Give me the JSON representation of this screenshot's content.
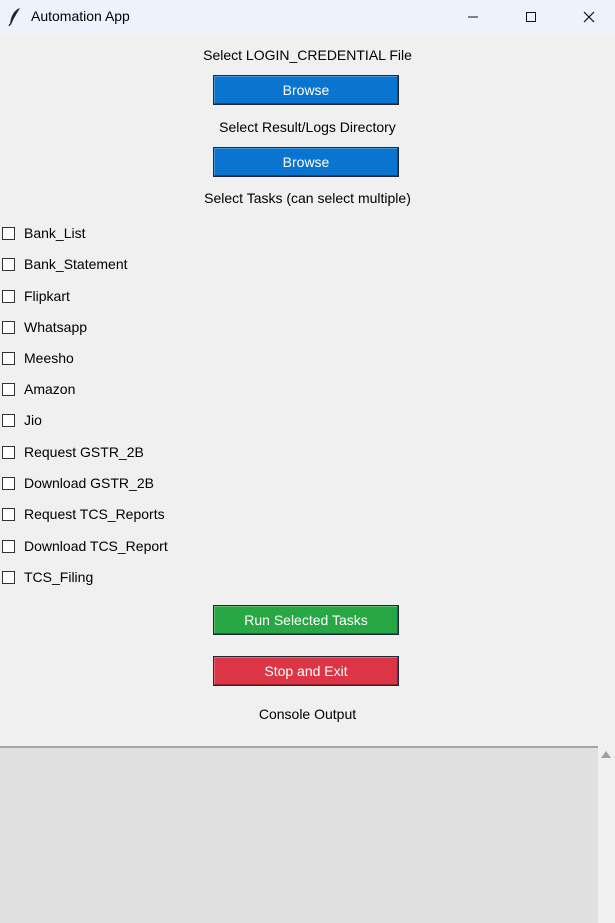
{
  "window": {
    "title": "Automation App"
  },
  "credentials": {
    "label": "Select LOGIN_CREDENTIAL File",
    "button": "Browse"
  },
  "logs": {
    "label": "Select Result/Logs Directory",
    "button": "Browse"
  },
  "tasks": {
    "label": "Select Tasks (can select multiple)",
    "items": [
      {
        "label": "Bank_List",
        "checked": false
      },
      {
        "label": "Bank_Statement",
        "checked": false
      },
      {
        "label": "Flipkart",
        "checked": false
      },
      {
        "label": "Whatsapp",
        "checked": false
      },
      {
        "label": "Meesho",
        "checked": false
      },
      {
        "label": "Amazon",
        "checked": false
      },
      {
        "label": "Jio",
        "checked": false
      },
      {
        "label": "Request GSTR_2B",
        "checked": false
      },
      {
        "label": "Download GSTR_2B",
        "checked": false
      },
      {
        "label": "Request TCS_Reports",
        "checked": false
      },
      {
        "label": "Download TCS_Report",
        "checked": false
      },
      {
        "label": "TCS_Filing",
        "checked": false
      }
    ]
  },
  "actions": {
    "run_label": "Run Selected Tasks",
    "stop_label": "Stop and Exit"
  },
  "console": {
    "label": "Console Output",
    "content": ""
  },
  "colors": {
    "browse": "#0a74d0",
    "run": "#28a745",
    "stop": "#dc3545"
  }
}
